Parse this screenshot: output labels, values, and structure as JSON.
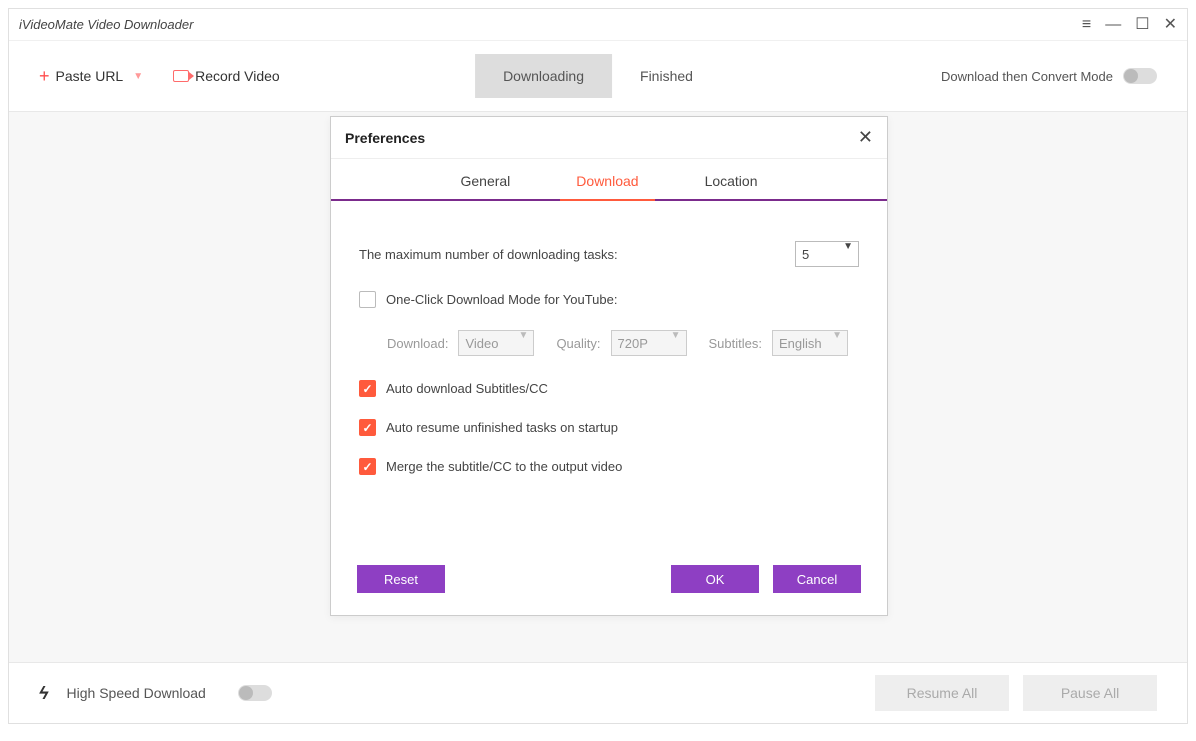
{
  "app_title": "iVideoMate Video Downloader",
  "toolbar": {
    "paste_url": "Paste URL",
    "record_video": "Record Video",
    "tabs": [
      "Downloading",
      "Finished"
    ],
    "active_tab": 0,
    "convert_mode_label": "Download then Convert Mode"
  },
  "bottombar": {
    "high_speed": "High Speed Download",
    "resume_all": "Resume All",
    "pause_all": "Pause All"
  },
  "modal": {
    "title": "Preferences",
    "tabs": [
      "General",
      "Download",
      "Location"
    ],
    "active_tab": 1,
    "max_tasks_label": "The maximum number of downloading tasks:",
    "max_tasks_value": "5",
    "one_click_label": "One-Click Download Mode for YouTube:",
    "one_click_checked": false,
    "download_label": "Download:",
    "download_value": "Video",
    "quality_label": "Quality:",
    "quality_value": "720P",
    "subtitles_label": "Subtitles:",
    "subtitles_value": "English",
    "auto_subtitles_label": "Auto download Subtitles/CC",
    "auto_resume_label": "Auto resume unfinished tasks on startup",
    "merge_label": "Merge the subtitle/CC to the output video",
    "reset": "Reset",
    "ok": "OK",
    "cancel": "Cancel"
  }
}
